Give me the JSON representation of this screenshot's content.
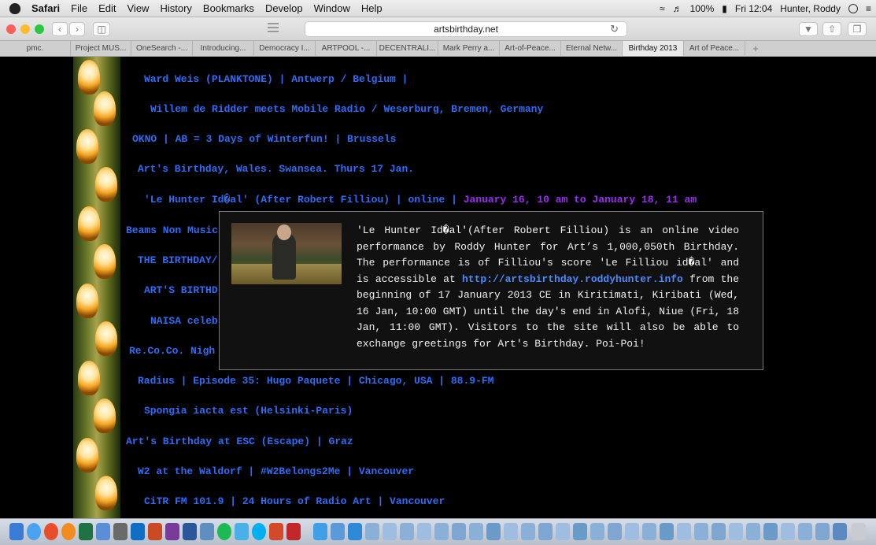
{
  "menubar": {
    "app": "Safari",
    "items": [
      "File",
      "Edit",
      "View",
      "History",
      "Bookmarks",
      "Develop",
      "Window",
      "Help"
    ],
    "battery": "100%",
    "clock": "Fri 12:04",
    "user": "Hunter, Roddy"
  },
  "toolbar": {
    "url": "artsbirthday.net"
  },
  "tabs": [
    {
      "label": "pmc."
    },
    {
      "label": "Project MUS..."
    },
    {
      "label": "OneSearch -..."
    },
    {
      "label": "Introducing..."
    },
    {
      "label": "Democracy I..."
    },
    {
      "label": "ARTPOOL -..."
    },
    {
      "label": "DECENTRALI..."
    },
    {
      "label": "Mark Perry a..."
    },
    {
      "label": "Art-of-Peace..."
    },
    {
      "label": "Eternal Netw..."
    },
    {
      "label": "Birthday 2013"
    },
    {
      "label": "Art of Peace..."
    }
  ],
  "events": [
    {
      "text": "Ward Weis (PLANKTONE) | Antwerp / Belgium |"
    },
    {
      "text": "Willem de Ridder meets Mobile Radio / Weserburg, Bremen, Germany"
    },
    {
      "text": "OKNO | AB = 3 Days of Winterfun! | Brussels"
    },
    {
      "text": "Art's Birthday, Wales. Swansea. Thurs 17 Jan."
    },
    {
      "text": "'Le Hunter Id�al' (After Robert Filliou) | online | ",
      "date": "January 16, 10 am to January 18, 11 am"
    },
    {
      "text": "Beams Non Music"
    },
    {
      "text": "THE BIRTHDAY/"
    },
    {
      "text": "ART'S BIRTHD"
    },
    {
      "text": "NAISA celeb"
    },
    {
      "text": "Re.Co.Co. Nigh"
    },
    {
      "text": "Radius | Episode 35: Hugo Paquete | Chicago, USA | 88.9-FM"
    },
    {
      "text": "Spongia iacta est (Helsinki-Paris)"
    },
    {
      "text": "Art's Birthday at ESC (Escape) | Graz"
    },
    {
      "text": "W2 at the Waldorf | #W2Belongs2Me | Vancouver"
    },
    {
      "text": "CiTR FM 101.9 | 24 Hours of Radio Art | Vancouver"
    }
  ],
  "popup": {
    "text_before_link": "'Le Hunter Id�al'(After Robert Filliou) is an online video performance by Roddy Hunter for Art’s 1,000,050th Birthday. The performance is of Filliou's score 'Le Filliou id�al' and is accessible at ",
    "link": "http://artsbirthday.roddyhunter.info",
    "text_after_link": " from the beginning of 17 January 2013 CE in Kiritimati, Kiribati (Wed, 16 Jan, 10:00 GMT) until the day's end in Alofi, Niue (Fri, 18 Jan, 11:00 GMT). Visitors to the site will also be able to exchange greetings for Art's Birthday. Poi-Poi!"
  }
}
